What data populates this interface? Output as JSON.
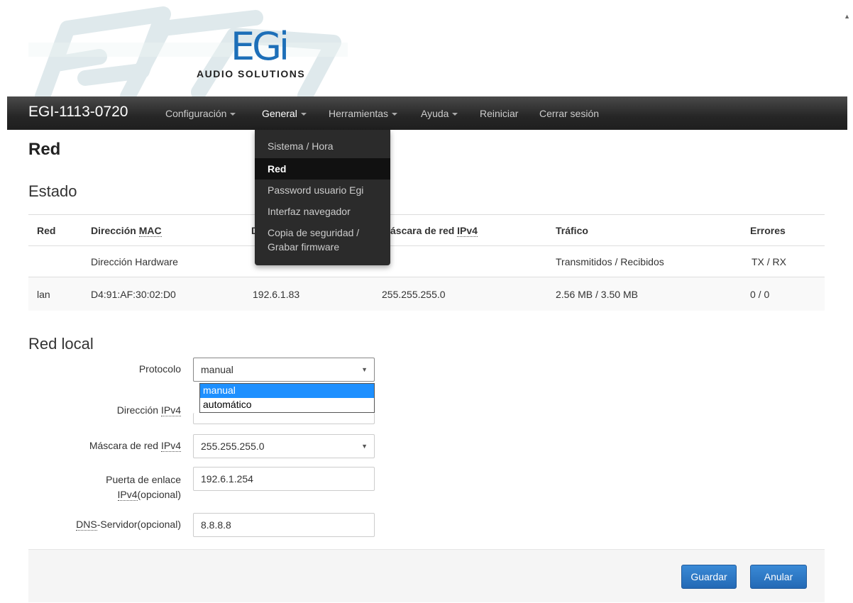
{
  "logo": {
    "brand": "EGi",
    "tagline": "AUDIO SOLUTIONS"
  },
  "nav": {
    "brand": "EGI-1113-0720",
    "items": [
      {
        "label": "Configuración",
        "dropdown": true
      },
      {
        "label": "General",
        "dropdown": true
      },
      {
        "label": "Herramientas",
        "dropdown": true
      },
      {
        "label": "Ayuda",
        "dropdown": true
      },
      {
        "label": "Reiniciar",
        "dropdown": false
      },
      {
        "label": "Cerrar sesión",
        "dropdown": false
      }
    ]
  },
  "general_menu": {
    "items": [
      {
        "label": "Sistema / Hora"
      },
      {
        "label": "Red",
        "active": true
      },
      {
        "label": "Password usuario Egi"
      },
      {
        "label": "Interfaz navegador"
      },
      {
        "label": "Copia de seguridad /",
        "label2": "Grabar firmware"
      }
    ]
  },
  "page": {
    "title": "Red"
  },
  "status": {
    "title": "Estado",
    "headers": [
      "Red",
      "Dirección ",
      "MAC",
      "D",
      "áscara de red ",
      "IPv4",
      "Tráfico",
      "Errores"
    ],
    "subheaders": {
      "mac": "Dirección Hardware",
      "traffic": "Transmitidos / Recibidos",
      "errors": "TX / RX"
    },
    "rows": [
      {
        "net": "lan",
        "mac": "D4:91:AF:30:02:D0",
        "ip": "192.6.1.83",
        "mask": "255.255.255.0",
        "traffic": "2.56 MB / 3.50 MB",
        "errors": "0 / 0"
      }
    ]
  },
  "lan": {
    "title": "Red local",
    "protocol_label": "Protocolo",
    "protocol_value": "manual",
    "protocol_options": [
      "manual",
      "automático"
    ],
    "ip_label_prefix": "Dirección ",
    "ip_label_abbr": "IPv4",
    "mask_label_prefix": "Máscara de red ",
    "mask_label_abbr": "IPv4",
    "mask_value": "255.255.255.0",
    "gateway_label_line1": "Puerta de enlace",
    "gateway_label_abbr": "IPv4",
    "gateway_label_suffix": "(opcional)",
    "gateway_value": "192.6.1.254",
    "dns_label_abbr": "DNS",
    "dns_label_suffix": "-Servidor(opcional)",
    "dns_value": "8.8.8.8"
  },
  "footer": {
    "save": "Guardar",
    "cancel": "Anular"
  },
  "colors": {
    "primary": "#2a74c4",
    "navbar": "#262626",
    "select_highlight": "#1e90ff"
  }
}
